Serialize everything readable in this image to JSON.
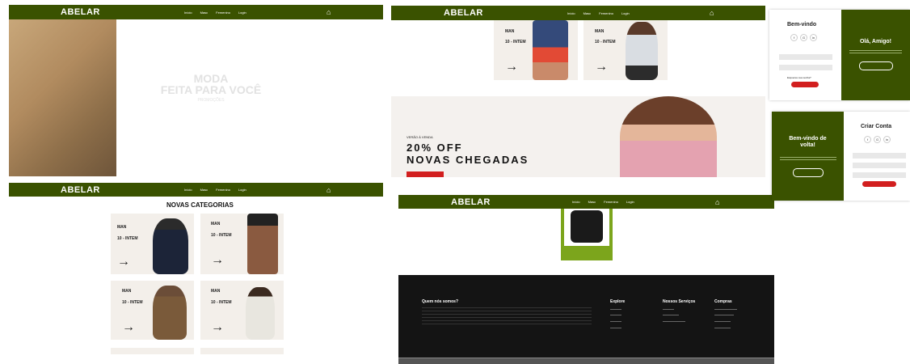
{
  "brand": "ABELAR",
  "nav": {
    "links": [
      "Início",
      "Masc",
      "Femenino",
      "Login"
    ]
  },
  "hero": {
    "line1": "MODA",
    "line2": "FEITA PARA VOCÊ",
    "cta": "PROMOÇÕES"
  },
  "categories": {
    "title": "NOVAS CATEGORIAS",
    "cards": [
      {
        "tag": "MAN",
        "label": "10 - INTEM"
      },
      {
        "tag": "MAN",
        "label": "10 - INTEM"
      },
      {
        "tag": "MAN",
        "label": "10 - INTEM"
      },
      {
        "tag": "MAN",
        "label": "10 - INTEM"
      }
    ],
    "top_cards": [
      {
        "tag": "MAN",
        "label": "10 - INTEM"
      },
      {
        "tag": "MAN",
        "label": "10 - INTEM"
      }
    ]
  },
  "promo": {
    "kicker": "VERÃO À VENDA",
    "headline1": "20% OFF",
    "headline2": "NOVAS CHEGADAS"
  },
  "login": {
    "welcome": "Bem-vindo",
    "hello": "Olá, Amigo!",
    "forgot": "Esqueceu sua senha?",
    "create_title": "Criar Conta",
    "welcome_back_line1": "Bem-vindo de",
    "welcome_back_line2": "volta!"
  },
  "footer": {
    "about_title": "Quem nós somos?",
    "cols": [
      {
        "title": "Explore",
        "items": [
          "",
          "",
          "",
          ""
        ]
      },
      {
        "title": "Nossos Serviços",
        "items": [
          "",
          "",
          ""
        ]
      },
      {
        "title": "Compras",
        "items": [
          "",
          "",
          "",
          ""
        ]
      }
    ]
  },
  "icons": [
    "cart-icon",
    "arrow-right-icon"
  ],
  "colors": {
    "brand_green": "#3a5200",
    "accent_red": "#d21f1f",
    "footer_black": "#141414"
  }
}
